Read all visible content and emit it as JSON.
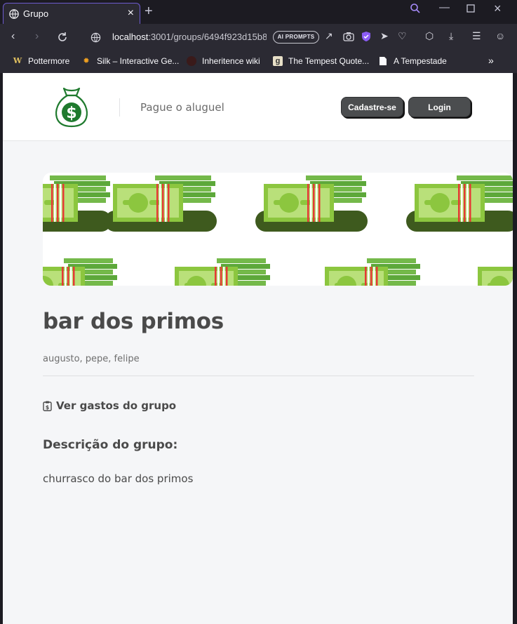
{
  "browser": {
    "tab_title": "Grupo",
    "url_host": "localhost",
    "url_path": ":3001/groups/6494f923d15b8",
    "ai_prompts_label": "AI PROMPTS",
    "bookmarks": [
      {
        "label": "Pottermore",
        "icon": "W"
      },
      {
        "label": "Silk – Interactive Ge...",
        "icon": "silk-icon"
      },
      {
        "label": "Inheritence wiki",
        "icon": "inheritance-icon"
      },
      {
        "label": "The Tempest Quote...",
        "icon": "g"
      },
      {
        "label": "A Tempestade",
        "icon": "document-icon"
      }
    ],
    "overflow_label": "»"
  },
  "header": {
    "nav_link": "Pague o aluguel",
    "signup_label": "Cadastre-se",
    "login_label": "Login"
  },
  "group": {
    "title": "bar dos primos",
    "members": "augusto, pepe, felipe",
    "expenses_link": "Ver gastos do grupo",
    "description_heading": "Descrição do grupo:",
    "description": "churrasco do bar dos primos"
  },
  "colors": {
    "button_bg": "#4b4d4f",
    "page_bg": "#f5f6f8",
    "money_green": "#8cc63f",
    "money_dark": "#3e5a1e",
    "band_red": "#e53935",
    "logo_green": "#1f7a2e"
  }
}
